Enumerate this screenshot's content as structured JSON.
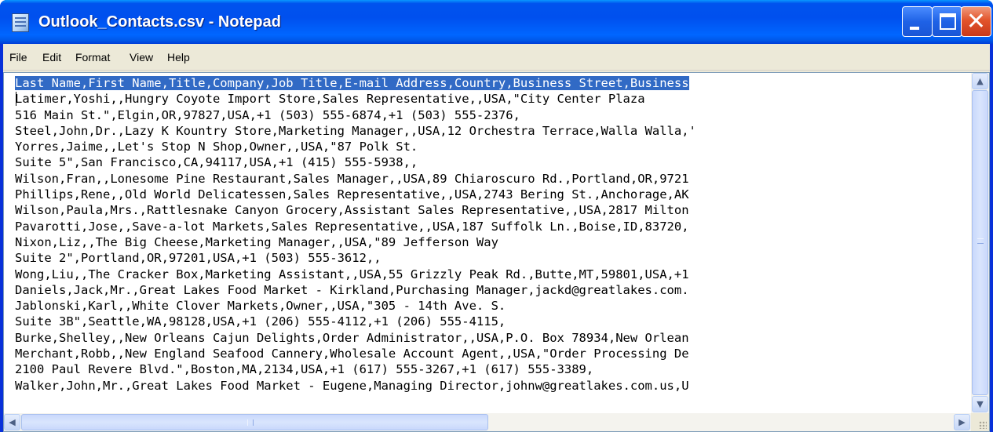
{
  "window": {
    "title": "Outlook_Contacts.csv - Notepad",
    "icon": "notepad-icon"
  },
  "caption_buttons": {
    "minimize": "minimize-icon",
    "maximize": "maximize-icon",
    "close": "close-icon",
    "close_glyph": "✕"
  },
  "menu": {
    "items": [
      "File",
      "Edit",
      "Format",
      "View",
      "Help"
    ]
  },
  "editor": {
    "lines": [
      "Last Name,First Name,Title,Company,Job Title,E-mail Address,Country,Business Street,Business",
      "Latimer,Yoshi,,Hungry Coyote Import Store,Sales Representative,,USA,\"City Center Plaza",
      "516 Main St.\",Elgin,OR,97827,USA,+1 (503) 555-6874,+1 (503) 555-2376,",
      "Steel,John,Dr.,Lazy K Kountry Store,Marketing Manager,,USA,12 Orchestra Terrace,Walla Walla,'",
      "Yorres,Jaime,,Let's Stop N Shop,Owner,,USA,\"87 Polk St.",
      "Suite 5\",San Francisco,CA,94117,USA,+1 (415) 555-5938,,",
      "Wilson,Fran,,Lonesome Pine Restaurant,Sales Manager,,USA,89 Chiaroscuro Rd.,Portland,OR,9721",
      "Phillips,Rene,,Old World Delicatessen,Sales Representative,,USA,2743 Bering St.,Anchorage,AK",
      "Wilson,Paula,Mrs.,Rattlesnake Canyon Grocery,Assistant Sales Representative,,USA,2817 Milton",
      "Pavarotti,Jose,,Save-a-lot Markets,Sales Representative,,USA,187 Suffolk Ln.,Boise,ID,83720,",
      "Nixon,Liz,,The Big Cheese,Marketing Manager,,USA,\"89 Jefferson Way",
      "Suite 2\",Portland,OR,97201,USA,+1 (503) 555-3612,,",
      "Wong,Liu,,The Cracker Box,Marketing Assistant,,USA,55 Grizzly Peak Rd.,Butte,MT,59801,USA,+1",
      "Daniels,Jack,Mr.,Great Lakes Food Market - Kirkland,Purchasing Manager,jackd@greatlakes.com.",
      "Jablonski,Karl,,White Clover Markets,Owner,,USA,\"305 - 14th Ave. S.",
      "Suite 3B\",Seattle,WA,98128,USA,+1 (206) 555-4112,+1 (206) 555-4115,",
      "Burke,Shelley,,New Orleans Cajun Delights,Order Administrator,,USA,P.O. Box 78934,New Orlean",
      "Merchant,Robb,,New England Seafood Cannery,Wholesale Account Agent,,USA,\"Order Processing De",
      "2100 Paul Revere Blvd.\",Boston,MA,2134,USA,+1 (617) 555-3267,+1 (617) 555-3389,",
      "Walker,John,Mr.,Great Lakes Food Market - Eugene,Managing Director,johnw@greatlakes.com.us,U"
    ],
    "selected_line_index": 0
  },
  "scrollbars": {
    "up_arrow": "▲",
    "down_arrow": "▼",
    "left_arrow": "◀",
    "right_arrow": "▶"
  },
  "colors": {
    "titlebar": "#0054e3",
    "selection": "#316ac5",
    "menubar": "#ece9d8"
  }
}
